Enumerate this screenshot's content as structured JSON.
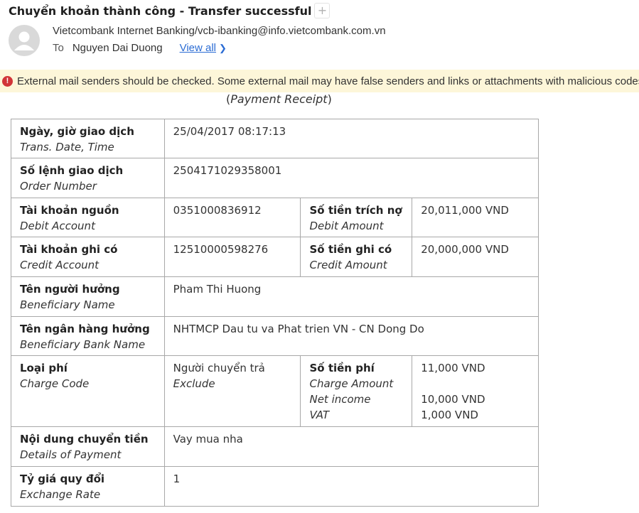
{
  "email": {
    "subject": "Chuyển khoản thành công - Transfer successful",
    "add_label": "+",
    "from": "Vietcombank Internet Banking/vcb-ibanking@info.vietcombank.com.vn",
    "to_label": "To",
    "recipient": "Nguyen Dai Duong",
    "view_all": "View all",
    "warning_icon": "!",
    "warning": "External mail senders should be checked. Some external mail may have false senders and links or attachments with malicious codes."
  },
  "receipt": {
    "open_paren": "(",
    "title": "Payment Receipt",
    "close_paren": ")"
  },
  "rows": {
    "date": {
      "label": "Ngày, giờ giao dịch",
      "sub": "Trans. Date, Time",
      "value": "25/04/2017 08:17:13"
    },
    "order": {
      "label": "Số lệnh giao dịch",
      "sub": "Order Number",
      "value": "2504171029358001"
    },
    "debit": {
      "label": "Tài khoản nguồn",
      "sub": "Debit Account",
      "value": "0351000836912",
      "amount_label": "Số tiền trích nợ",
      "amount_sub": "Debit Amount",
      "amount_value": "20,011,000 VND"
    },
    "credit": {
      "label": "Tài khoản ghi có",
      "sub": "Credit Account",
      "value": "12510000598276",
      "amount_label": "Số tiền ghi có",
      "amount_sub": "Credit Amount",
      "amount_value": "20,000,000 VND"
    },
    "beneficiary": {
      "label": "Tên người hưởng",
      "sub": "Beneficiary Name",
      "value": "Pham Thi Huong"
    },
    "bank": {
      "label": "Tên ngân hàng hưởng",
      "sub": "Beneficiary Bank Name",
      "value": "NHTMCP Dau tu va Phat trien VN - CN Dong Do"
    },
    "fee": {
      "label": "Loại phí",
      "sub": "Charge Code",
      "value": "Người chuyển trả",
      "value_sub": "Exclude",
      "amount_label": "Số tiền phí",
      "amount_sub": "Charge Amount",
      "net_label": "Net income",
      "vat_label": "VAT",
      "amount_value": "11,000 VND",
      "net_value": "10,000 VND",
      "vat_value": "1,000 VND"
    },
    "details": {
      "label": "Nội dung chuyển tiền",
      "sub": "Details of Payment",
      "value": "Vay mua nha"
    },
    "rate": {
      "label": "Tỷ giá quy đổi",
      "sub": "Exchange Rate",
      "value": "1"
    }
  }
}
